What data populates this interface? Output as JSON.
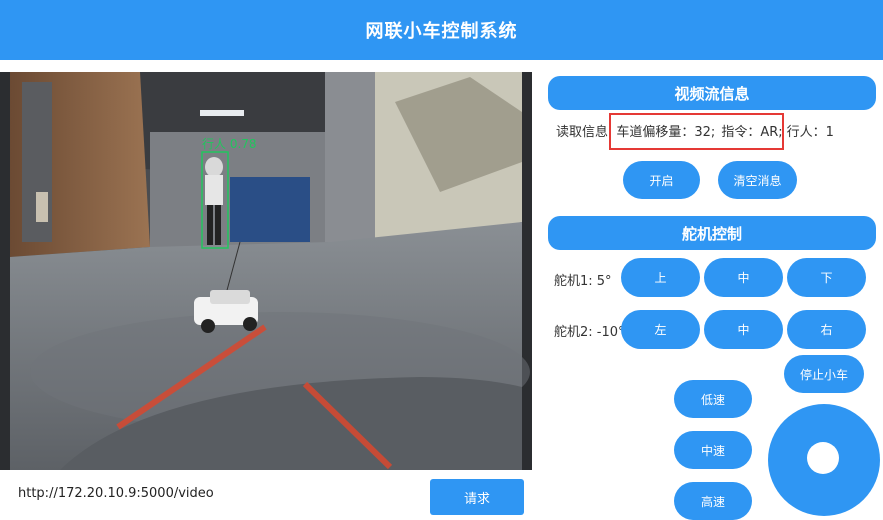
{
  "header": {
    "title": "网联小车控制系统"
  },
  "video": {
    "url": "http://172.20.10.9:5000/video",
    "request_label": "请求",
    "detection_label": "行人 0.78"
  },
  "stream_info": {
    "title": "视频流信息",
    "read_label": "读取信息:",
    "lane_offset": "车道偏移量：32;",
    "command": "指令：AR;",
    "pedestrian": "行人：1",
    "start_label": "开启",
    "clear_label": "清空消息"
  },
  "servo": {
    "title": "舵机控制",
    "servo1_label": "舵机1: 5°",
    "servo2_label": "舵机2: -10°",
    "up": "上",
    "mid": "中",
    "down": "下",
    "left": "左",
    "mid2": "中",
    "right": "右"
  },
  "car": {
    "stop_label": "停止小车",
    "low_speed": "低速",
    "mid_speed": "中速",
    "high_speed": "高速"
  },
  "colors": {
    "accent": "#2f96f3",
    "highlight": "#e53935",
    "detect": "#22c55e"
  }
}
